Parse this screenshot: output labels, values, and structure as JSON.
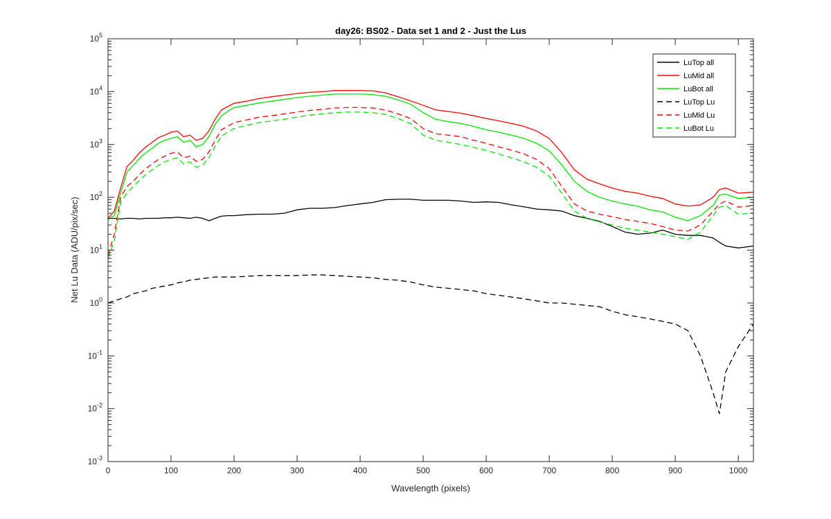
{
  "chart_data": {
    "type": "line",
    "title": "day26: BS02 - Data set 1 and 2 - Just the Lus",
    "xlabel": "Wavelength (pixels)",
    "ylabel": "Net Lu Data (ADU/pix/sec)",
    "xlim": [
      0,
      1024
    ],
    "ylim": [
      0.001,
      100000
    ],
    "yscale": "log",
    "grid": false,
    "legend_location": "top-right",
    "x_ticks": [
      "0",
      "100",
      "200",
      "300",
      "400",
      "500",
      "600",
      "700",
      "800",
      "900",
      "1000"
    ],
    "y_ticks": [
      {
        "base": "10",
        "exp": "-3"
      },
      {
        "base": "10",
        "exp": "-2"
      },
      {
        "base": "10",
        "exp": "-1"
      },
      {
        "base": "10",
        "exp": "0"
      },
      {
        "base": "10",
        "exp": "1"
      },
      {
        "base": "10",
        "exp": "2"
      },
      {
        "base": "10",
        "exp": "3"
      },
      {
        "base": "10",
        "exp": "4"
      },
      {
        "base": "10",
        "exp": "5"
      }
    ],
    "x": [
      0,
      10,
      20,
      30,
      40,
      50,
      60,
      70,
      80,
      90,
      100,
      110,
      120,
      130,
      140,
      150,
      160,
      170,
      180,
      190,
      200,
      220,
      240,
      260,
      280,
      300,
      320,
      340,
      360,
      380,
      400,
      420,
      440,
      460,
      480,
      500,
      520,
      540,
      560,
      580,
      600,
      620,
      640,
      660,
      680,
      700,
      720,
      740,
      760,
      780,
      800,
      820,
      840,
      860,
      880,
      900,
      920,
      940,
      960,
      970,
      980,
      1000,
      1024
    ],
    "series": [
      {
        "name": "LuTop  all",
        "color": "#000000",
        "dash": "solid",
        "values": [
          40,
          40,
          39,
          40,
          40,
          39,
          40,
          40,
          40,
          41,
          41,
          42,
          41,
          40,
          42,
          40,
          36,
          40,
          44,
          45,
          45,
          47,
          48,
          48,
          50,
          58,
          62,
          62,
          64,
          70,
          75,
          80,
          90,
          92,
          92,
          88,
          88,
          88,
          85,
          80,
          82,
          80,
          72,
          66,
          60,
          58,
          55,
          45,
          40,
          35,
          28,
          22,
          20,
          21,
          24,
          20,
          19,
          19,
          17,
          14,
          12,
          11,
          12
        ]
      },
      {
        "name": "LuMid  all",
        "color": "#ff0000",
        "dash": "solid",
        "values": [
          40,
          55,
          150,
          380,
          500,
          700,
          900,
          1100,
          1350,
          1500,
          1700,
          1800,
          1400,
          1500,
          1200,
          1300,
          1800,
          3000,
          4500,
          5200,
          6000,
          6600,
          7400,
          8000,
          8600,
          9200,
          9700,
          10000,
          10500,
          10500,
          10500,
          10300,
          9500,
          8000,
          6700,
          5500,
          4500,
          4200,
          3900,
          3500,
          3100,
          2800,
          2500,
          2200,
          1800,
          1300,
          700,
          330,
          220,
          180,
          150,
          130,
          120,
          105,
          95,
          75,
          68,
          72,
          100,
          140,
          150,
          120,
          125
        ]
      },
      {
        "name": "LuBot  all",
        "color": "#00e600",
        "dash": "solid",
        "values": [
          38,
          45,
          120,
          300,
          400,
          550,
          700,
          850,
          1050,
          1200,
          1300,
          1400,
          1100,
          1200,
          900,
          1000,
          1400,
          2400,
          3500,
          4200,
          5000,
          5500,
          6100,
          6600,
          7100,
          7700,
          8200,
          8600,
          9000,
          9000,
          9000,
          8800,
          8200,
          7000,
          5800,
          4000,
          3000,
          2700,
          2500,
          2200,
          1900,
          1700,
          1500,
          1300,
          1050,
          760,
          410,
          200,
          130,
          100,
          85,
          75,
          68,
          58,
          53,
          42,
          36,
          45,
          70,
          110,
          115,
          95,
          100
        ]
      },
      {
        "name": "LuTop  Lu",
        "color": "#000000",
        "dash": "dashed",
        "values": [
          1.0,
          1.1,
          1.2,
          1.3,
          1.5,
          1.6,
          1.7,
          1.9,
          2.0,
          2.1,
          2.2,
          2.4,
          2.5,
          2.7,
          2.8,
          2.9,
          3.0,
          3.1,
          3.1,
          3.1,
          3.1,
          3.2,
          3.3,
          3.3,
          3.3,
          3.3,
          3.4,
          3.4,
          3.3,
          3.2,
          3.1,
          3.0,
          2.8,
          2.7,
          2.5,
          2.2,
          2.0,
          1.9,
          1.8,
          1.7,
          1.5,
          1.4,
          1.3,
          1.2,
          1.1,
          1.0,
          1.0,
          0.95,
          0.9,
          0.85,
          0.7,
          0.6,
          0.55,
          0.5,
          0.45,
          0.4,
          0.3,
          0.1,
          0.02,
          0.008,
          0.05,
          0.15,
          0.4
        ]
      },
      {
        "name": "LuMid  Lu",
        "color": "#ff0000",
        "dash": "dashed",
        "values": [
          8,
          20,
          100,
          160,
          200,
          270,
          350,
          430,
          520,
          600,
          680,
          720,
          560,
          600,
          480,
          520,
          720,
          1200,
          1900,
          2200,
          2600,
          2900,
          3300,
          3500,
          3800,
          4100,
          4400,
          4600,
          4900,
          5000,
          5000,
          4900,
          4500,
          3800,
          3100,
          2000,
          1600,
          1500,
          1400,
          1200,
          1050,
          900,
          780,
          660,
          520,
          350,
          160,
          75,
          55,
          48,
          43,
          38,
          35,
          32,
          28,
          24,
          23,
          30,
          55,
          75,
          85,
          65,
          70
        ]
      },
      {
        "name": "LuBot  Lu",
        "color": "#00e600",
        "dash": "dashed",
        "values": [
          7,
          15,
          80,
          120,
          160,
          210,
          270,
          330,
          400,
          470,
          520,
          560,
          430,
          470,
          370,
          400,
          560,
          930,
          1450,
          1700,
          2000,
          2300,
          2600,
          2800,
          3000,
          3300,
          3600,
          3800,
          4000,
          4100,
          4100,
          4000,
          3700,
          3100,
          2500,
          1500,
          1200,
          1100,
          1000,
          880,
          770,
          660,
          560,
          470,
          370,
          250,
          120,
          55,
          40,
          34,
          30,
          26,
          24,
          22,
          20,
          18,
          16,
          22,
          45,
          65,
          70,
          48,
          50
        ]
      }
    ]
  }
}
